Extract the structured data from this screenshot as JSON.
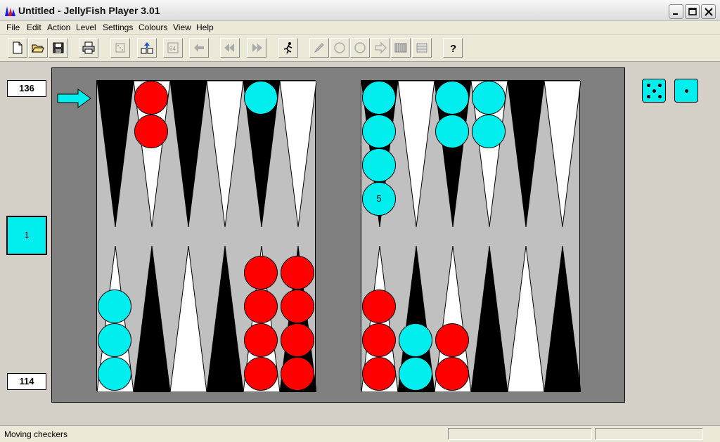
{
  "window": {
    "title": "Untitled - JellyFish Player 3.01"
  },
  "menu": [
    "File",
    "Edit",
    "Action",
    "Level",
    "Settings",
    "Colours",
    "View",
    "Help"
  ],
  "toolbar": {
    "buttons": [
      "new-file-icon",
      "open-folder-icon",
      "save-icon",
      "print-icon",
      "roll-dice-icon",
      "setup-position-icon",
      "cube-64-icon",
      "undo-arrow-icon",
      "rewind-icon",
      "fast-forward-icon",
      "running-man-icon",
      "pencil-icon",
      "empty-circle-icon",
      "empty-circle-icon",
      "next-arrow-icon",
      "edit-board-icon",
      "grid-board-icon",
      "help-icon"
    ]
  },
  "scores": {
    "top": "136",
    "bottom": "114"
  },
  "cube": {
    "value": "1"
  },
  "stack_label": "5",
  "dice": [
    5,
    1
  ],
  "colors": {
    "player": "#00eeee",
    "opponent": "#ff0000",
    "board_bg": "#808080",
    "board_field": "#c0c0c0"
  },
  "checkers": [
    {
      "point": "top-left-2",
      "color": "red",
      "count": 2
    },
    {
      "point": "top-left-5",
      "color": "cyan",
      "count": 1
    },
    {
      "point": "top-right-1",
      "color": "cyan",
      "count": 5,
      "label": "5"
    },
    {
      "point": "top-right-3",
      "color": "cyan",
      "count": 2
    },
    {
      "point": "top-right-4",
      "color": "cyan",
      "count": 2
    },
    {
      "point": "bottom-left-1",
      "color": "cyan",
      "count": 3
    },
    {
      "point": "bottom-left-5",
      "color": "red",
      "count": 4
    },
    {
      "point": "bottom-left-6",
      "color": "red",
      "count": 4
    },
    {
      "point": "bottom-right-1",
      "color": "red",
      "count": 3
    },
    {
      "point": "bottom-right-2",
      "color": "cyan",
      "count": 2
    },
    {
      "point": "bottom-right-3",
      "color": "red",
      "count": 2
    }
  ],
  "status": {
    "text": "Moving checkers"
  }
}
